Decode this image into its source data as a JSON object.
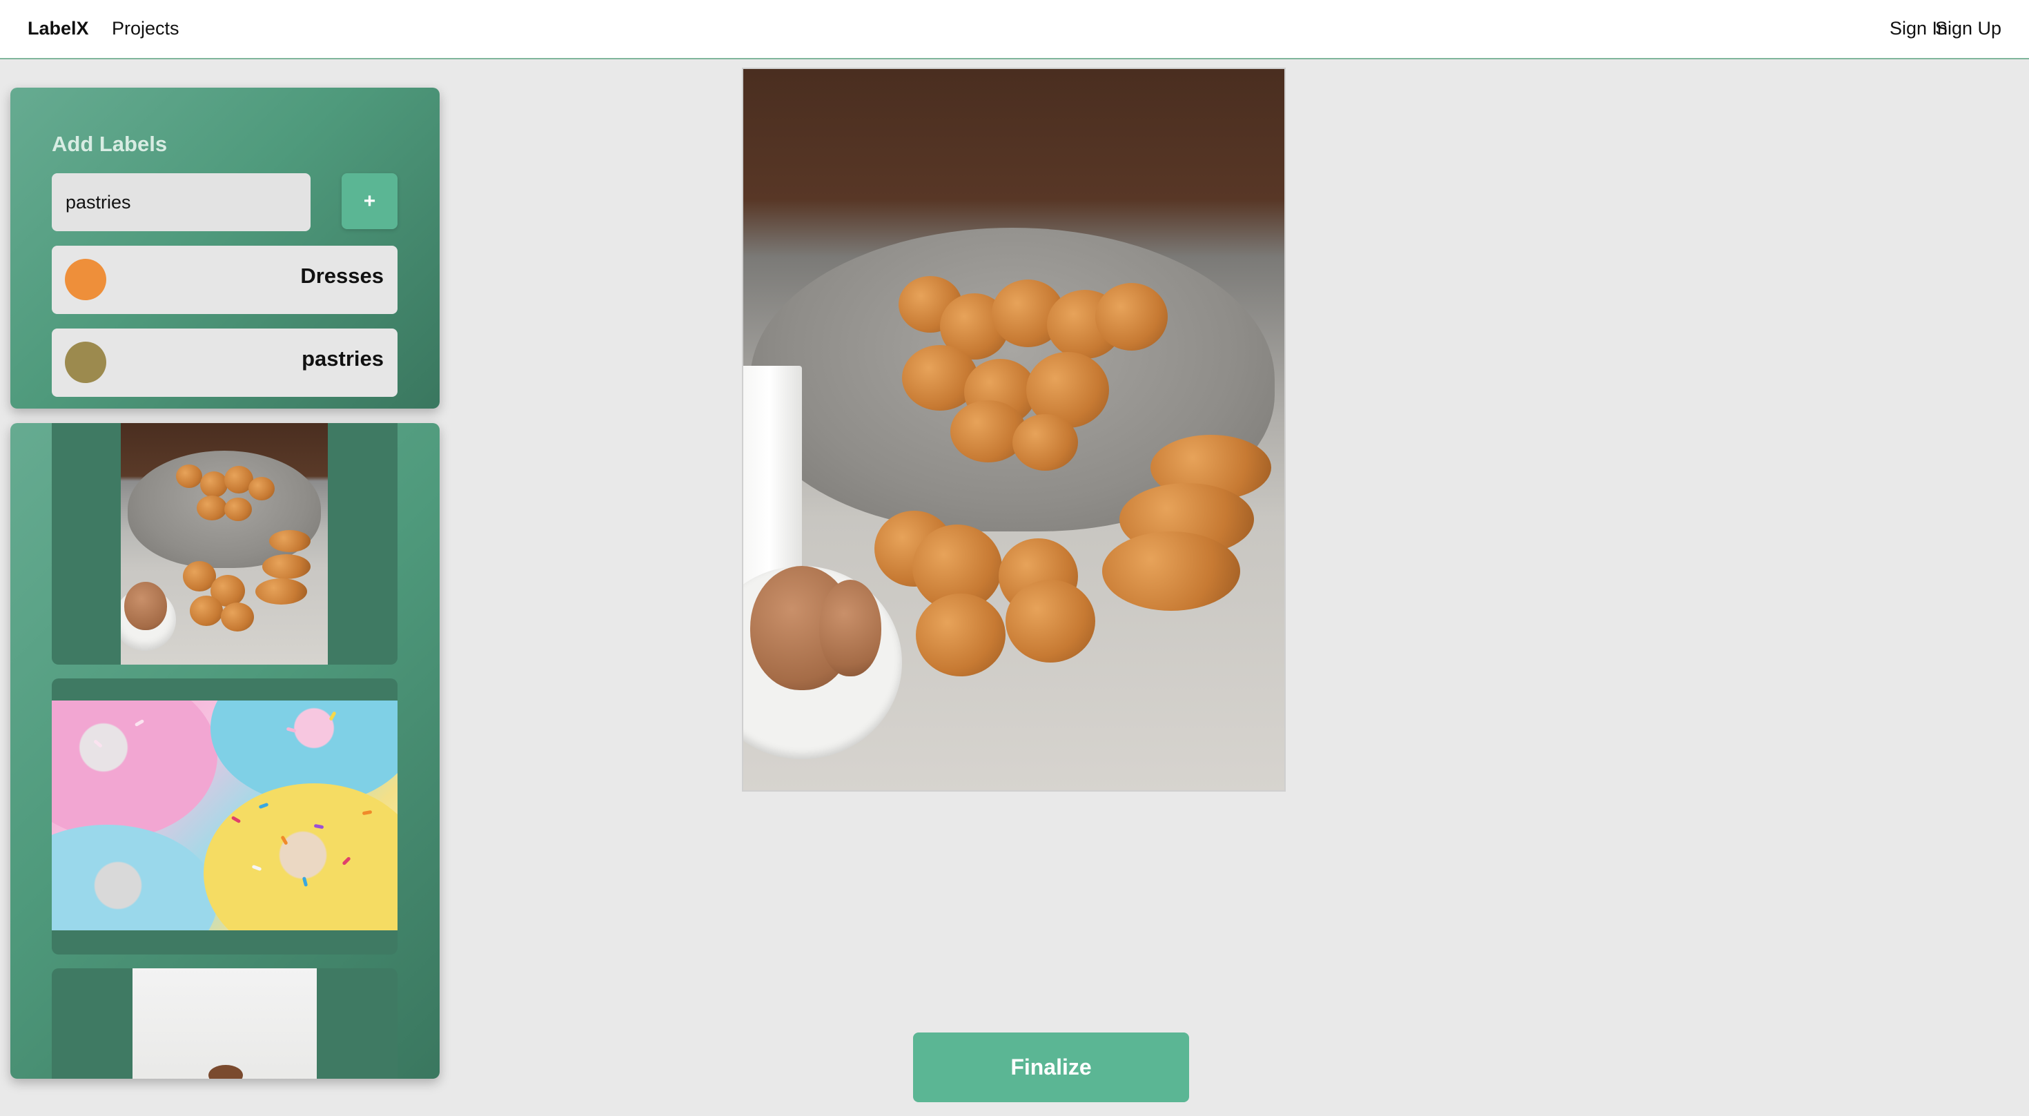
{
  "nav": {
    "brand": "LabelX",
    "projects": "Projects",
    "sign_in": "Sign In",
    "sign_up": "Sign Up"
  },
  "labels_panel": {
    "title": "Add Labels",
    "input_value": "pastries",
    "add_button": "+",
    "labels": [
      {
        "name": "Dresses",
        "color": "#ee8f3a"
      },
      {
        "name": "pastries",
        "color": "#9c8a4e"
      }
    ]
  },
  "finalize_button": "Finalize",
  "colors": {
    "accent": "#5bb694",
    "panel_gradient_start": "#66ab91",
    "panel_gradient_end": "#3a775f",
    "background": "#e9e9e9"
  }
}
